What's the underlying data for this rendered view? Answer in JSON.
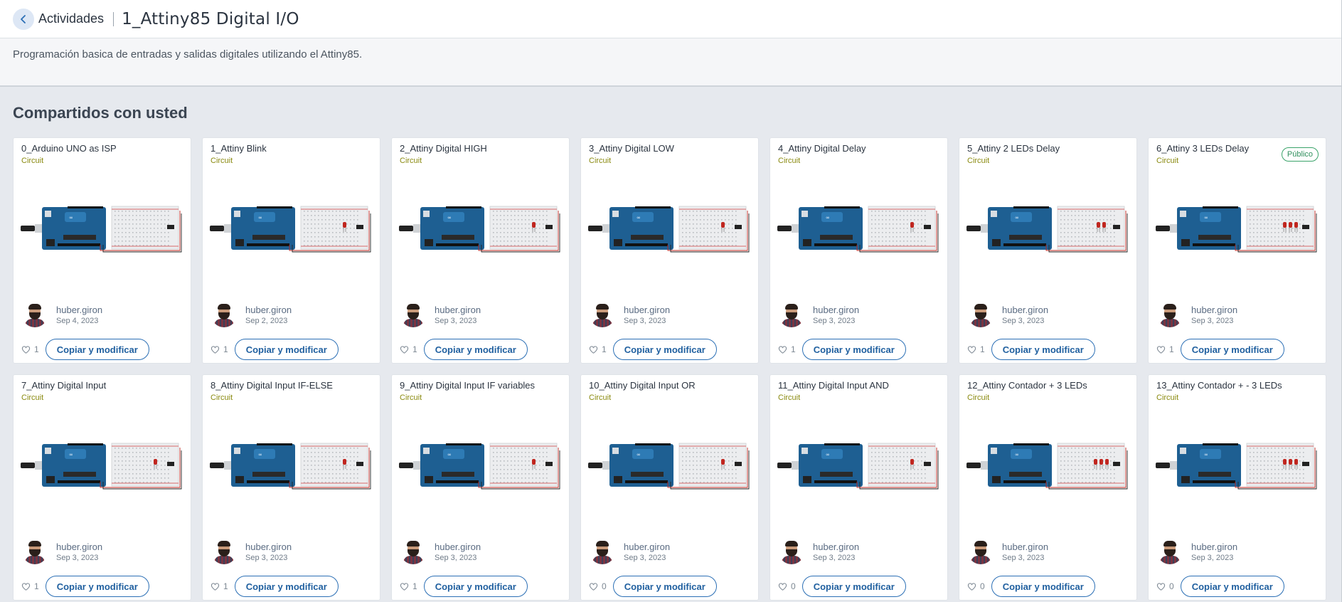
{
  "header": {
    "back_label": "Actividades",
    "title": "1_Attiny85 Digital I/O"
  },
  "description": "Programación basica de entradas y salidas digitales utilizando el Attiny85.",
  "section_title": "Compartidos con usted",
  "colors": {
    "accent": "#2b6fb5",
    "type_label": "#8a8a10",
    "badge_green": "#2f8f5c",
    "board_blue": "#1e5f92"
  },
  "cards": [
    {
      "name": "0_Arduino UNO as ISP",
      "type": "Circuit",
      "author": "huber.giron",
      "date": "Sep 4, 2023",
      "likes": "1",
      "action": "Copiar y modificar",
      "badge": "",
      "leds": 0,
      "icon": "circuit-thumbnail"
    },
    {
      "name": "1_Attiny Blink",
      "type": "Circuit",
      "author": "huber.giron",
      "date": "Sep 2, 2023",
      "likes": "1",
      "action": "Copiar y modificar",
      "badge": "",
      "leds": 1,
      "icon": "circuit-thumbnail"
    },
    {
      "name": "2_Attiny Digital HIGH",
      "type": "Circuit",
      "author": "huber.giron",
      "date": "Sep 3, 2023",
      "likes": "1",
      "action": "Copiar y modificar",
      "badge": "",
      "leds": 1,
      "icon": "circuit-thumbnail"
    },
    {
      "name": "3_Attiny Digital LOW",
      "type": "Circuit",
      "author": "huber.giron",
      "date": "Sep 3, 2023",
      "likes": "1",
      "action": "Copiar y modificar",
      "badge": "",
      "leds": 1,
      "icon": "circuit-thumbnail"
    },
    {
      "name": "4_Attiny Digital Delay",
      "type": "Circuit",
      "author": "huber.giron",
      "date": "Sep 3, 2023",
      "likes": "1",
      "action": "Copiar y modificar",
      "badge": "",
      "leds": 1,
      "icon": "circuit-thumbnail"
    },
    {
      "name": "5_Attiny 2 LEDs Delay",
      "type": "Circuit",
      "author": "huber.giron",
      "date": "Sep 3, 2023",
      "likes": "1",
      "action": "Copiar y modificar",
      "badge": "",
      "leds": 2,
      "icon": "circuit-thumbnail"
    },
    {
      "name": "6_Attiny 3 LEDs Delay",
      "type": "Circuit",
      "author": "huber.giron",
      "date": "Sep 3, 2023",
      "likes": "1",
      "action": "Copiar y modificar",
      "badge": "Público",
      "leds": 3,
      "icon": "circuit-thumbnail"
    },
    {
      "name": "7_Attiny Digital Input",
      "type": "Circuit",
      "author": "huber.giron",
      "date": "Sep 3, 2023",
      "likes": "1",
      "action": "Copiar y modificar",
      "badge": "",
      "leds": 1,
      "icon": "circuit-thumbnail"
    },
    {
      "name": "8_Attiny Digital Input IF-ELSE",
      "type": "Circuit",
      "author": "huber.giron",
      "date": "Sep 3, 2023",
      "likes": "1",
      "action": "Copiar y modificar",
      "badge": "",
      "leds": 1,
      "icon": "circuit-thumbnail"
    },
    {
      "name": "9_Attiny Digital Input IF variables",
      "type": "Circuit",
      "author": "huber.giron",
      "date": "Sep 3, 2023",
      "likes": "1",
      "action": "Copiar y modificar",
      "badge": "",
      "leds": 1,
      "icon": "circuit-thumbnail"
    },
    {
      "name": "10_Attiny Digital Input OR",
      "type": "Circuit",
      "author": "huber.giron",
      "date": "Sep 3, 2023",
      "likes": "0",
      "action": "Copiar y modificar",
      "badge": "",
      "leds": 1,
      "icon": "circuit-thumbnail"
    },
    {
      "name": "11_Attiny Digital Input AND",
      "type": "Circuit",
      "author": "huber.giron",
      "date": "Sep 3, 2023",
      "likes": "0",
      "action": "Copiar y modificar",
      "badge": "",
      "leds": 1,
      "icon": "circuit-thumbnail"
    },
    {
      "name": "12_Attiny Contador + 3 LEDs",
      "type": "Circuit",
      "author": "huber.giron",
      "date": "Sep 3, 2023",
      "likes": "0",
      "action": "Copiar y modificar",
      "badge": "",
      "leds": 3,
      "icon": "circuit-thumbnail"
    },
    {
      "name": "13_Attiny Contador + - 3 LEDs",
      "type": "Circuit",
      "author": "huber.giron",
      "date": "Sep 3, 2023",
      "likes": "0",
      "action": "Copiar y modificar",
      "badge": "",
      "leds": 3,
      "icon": "circuit-thumbnail"
    }
  ]
}
